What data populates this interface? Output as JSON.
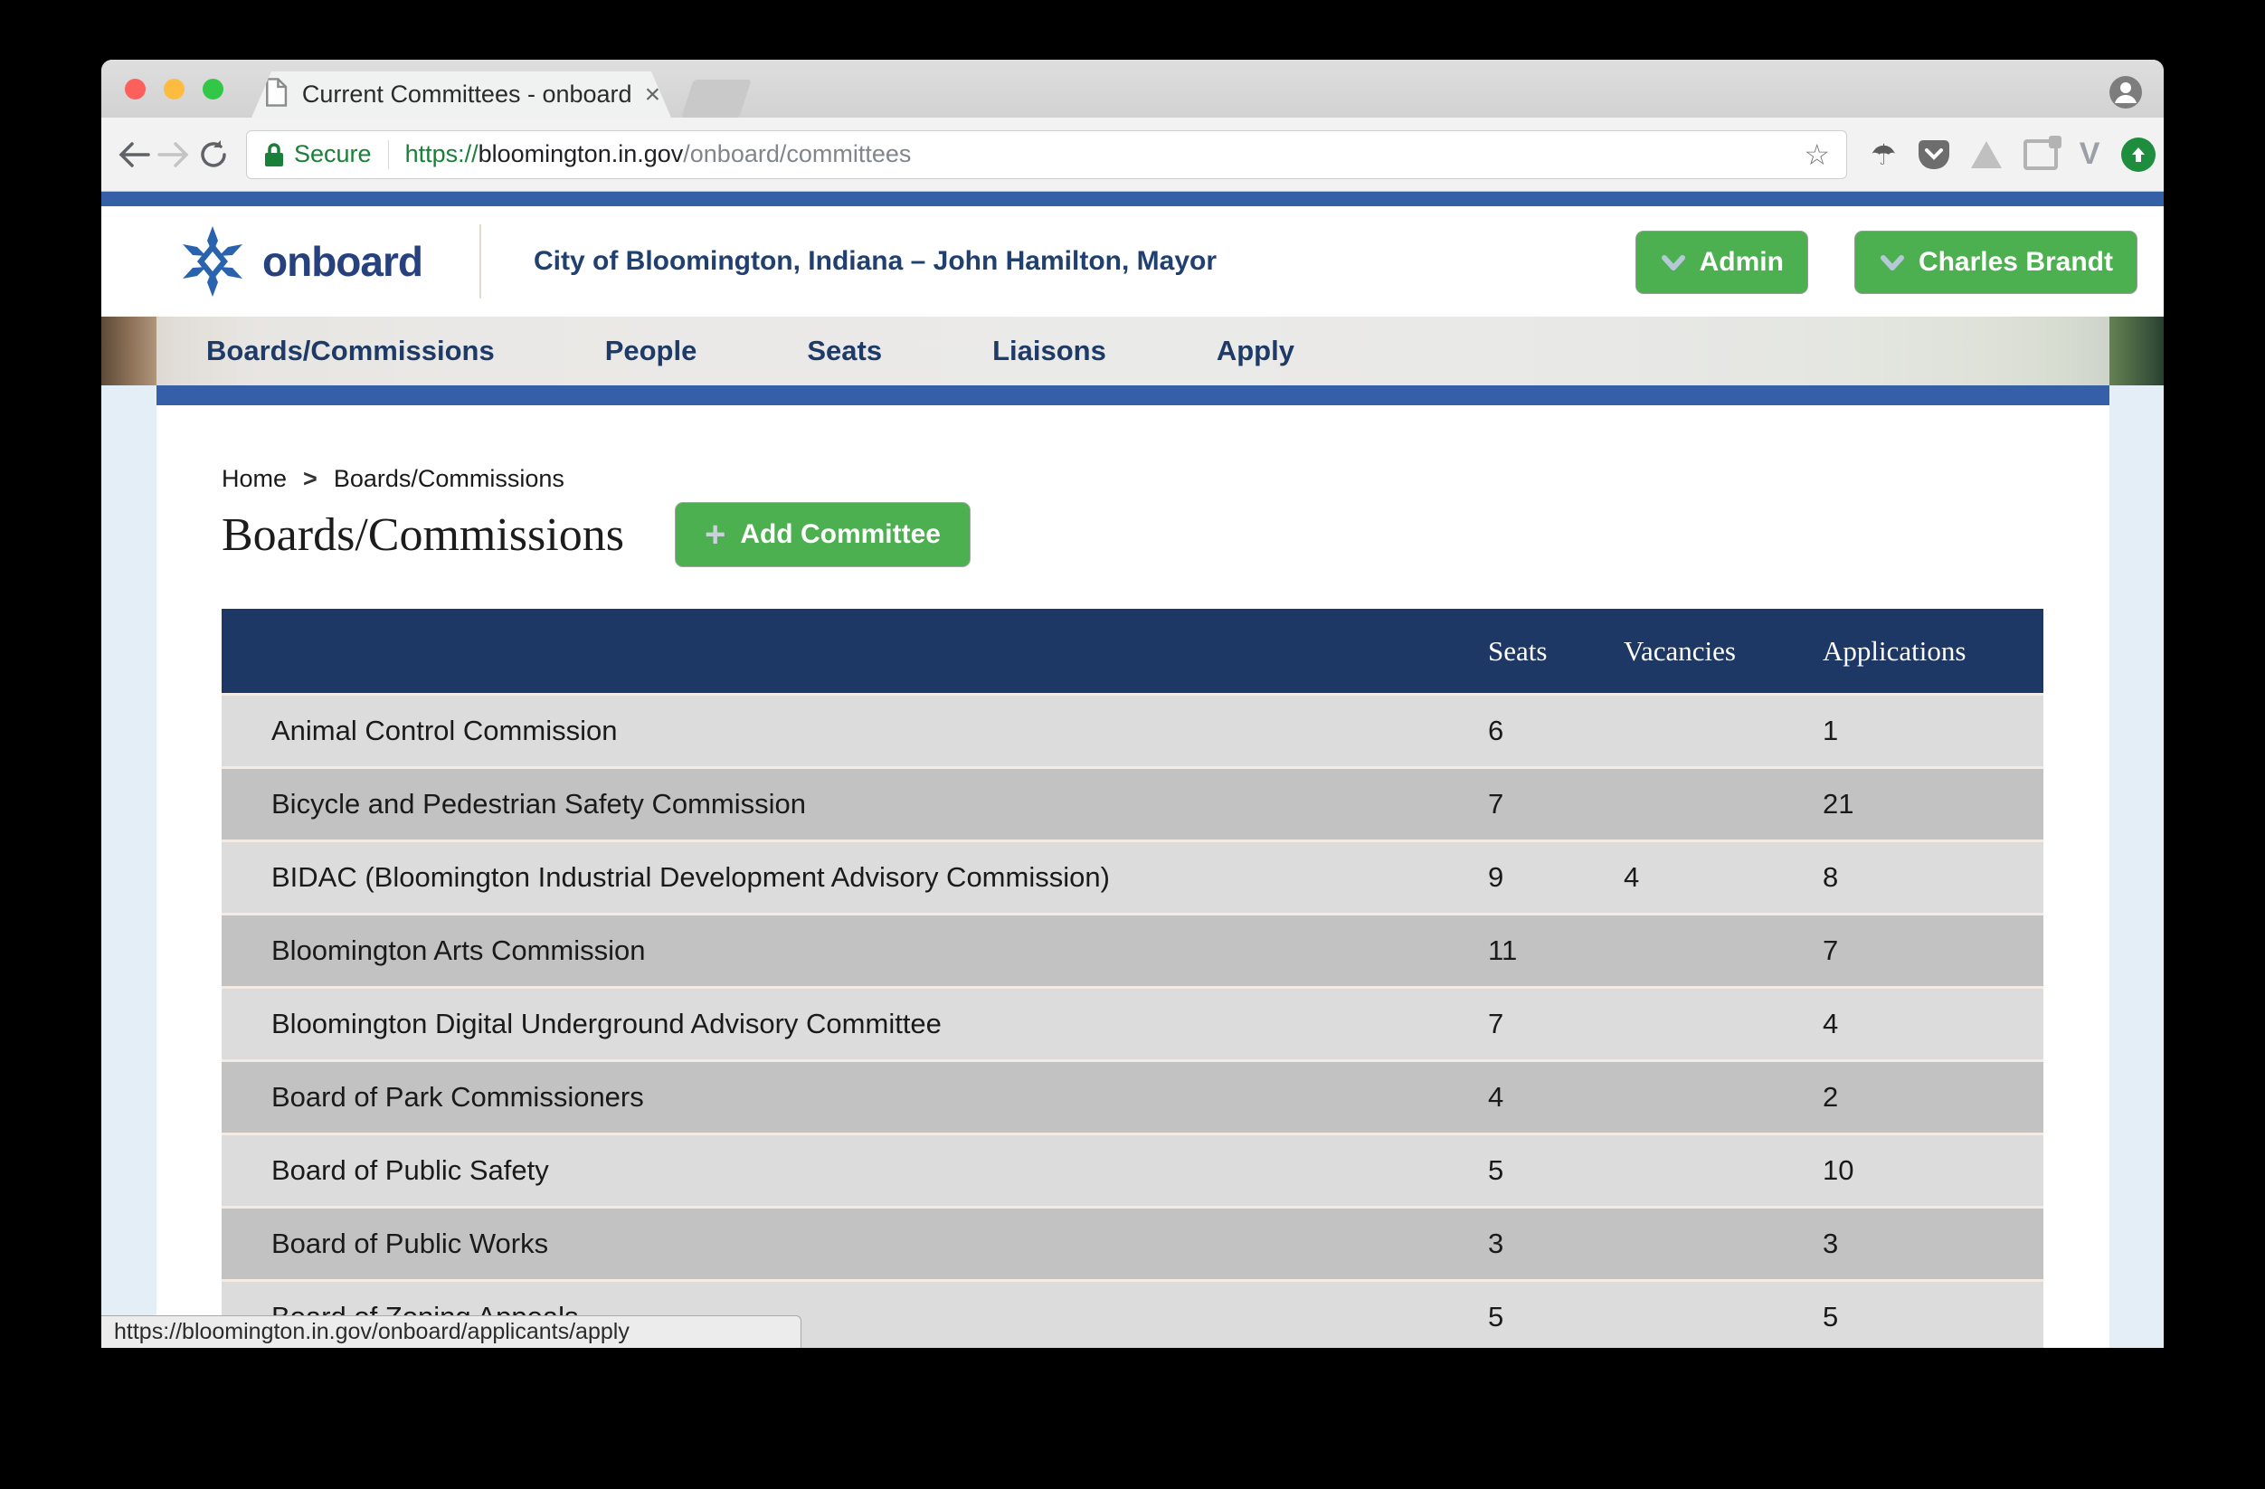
{
  "browser": {
    "tab_title": "Current Committees - onboard",
    "tab_close": "×",
    "secure_label": "Secure",
    "url_protocol": "https://",
    "url_domain": "bloomington.in.gov",
    "url_path": "/onboard/committees",
    "status_url": "https://bloomington.in.gov/onboard/applicants/apply"
  },
  "header": {
    "logo_text": "onboard",
    "site_title": "City of Bloomington, Indiana – John Hamilton, Mayor",
    "admin_label": "Admin",
    "user_label": "Charles Brandt"
  },
  "nav": {
    "items": [
      "Boards/Commissions",
      "People",
      "Seats",
      "Liaisons",
      "Apply"
    ]
  },
  "breadcrumb": {
    "home": "Home",
    "separator": ">",
    "current": "Boards/Commissions"
  },
  "main": {
    "title": "Boards/Commissions",
    "add_button": "Add Committee",
    "plus_icon": "+"
  },
  "table": {
    "columns": [
      "Seats",
      "Vacancies",
      "Applications"
    ],
    "rows": [
      {
        "name": "Animal Control Commission",
        "seats": "6",
        "vacancies": "",
        "applications": "1"
      },
      {
        "name": "Bicycle and Pedestrian Safety Commission",
        "seats": "7",
        "vacancies": "",
        "applications": "21"
      },
      {
        "name": "BIDAC (Bloomington Industrial Development Advisory Commission)",
        "seats": "9",
        "vacancies": "4",
        "applications": "8"
      },
      {
        "name": "Bloomington Arts Commission",
        "seats": "11",
        "vacancies": "",
        "applications": "7"
      },
      {
        "name": "Bloomington Digital Underground Advisory Committee",
        "seats": "7",
        "vacancies": "",
        "applications": "4"
      },
      {
        "name": "Board of Park Commissioners",
        "seats": "4",
        "vacancies": "",
        "applications": "2"
      },
      {
        "name": "Board of Public Safety",
        "seats": "5",
        "vacancies": "",
        "applications": "10"
      },
      {
        "name": "Board of Public Works",
        "seats": "3",
        "vacancies": "",
        "applications": "3"
      },
      {
        "name": "Board of Zoning Appeals",
        "seats": "5",
        "vacancies": "",
        "applications": "5"
      }
    ]
  },
  "colors": {
    "accent_green": "#4caf50",
    "navy_header": "#1e3866",
    "site_blue": "#3560a8",
    "secure_green": "#188038",
    "page_background": "#e4eef7"
  }
}
